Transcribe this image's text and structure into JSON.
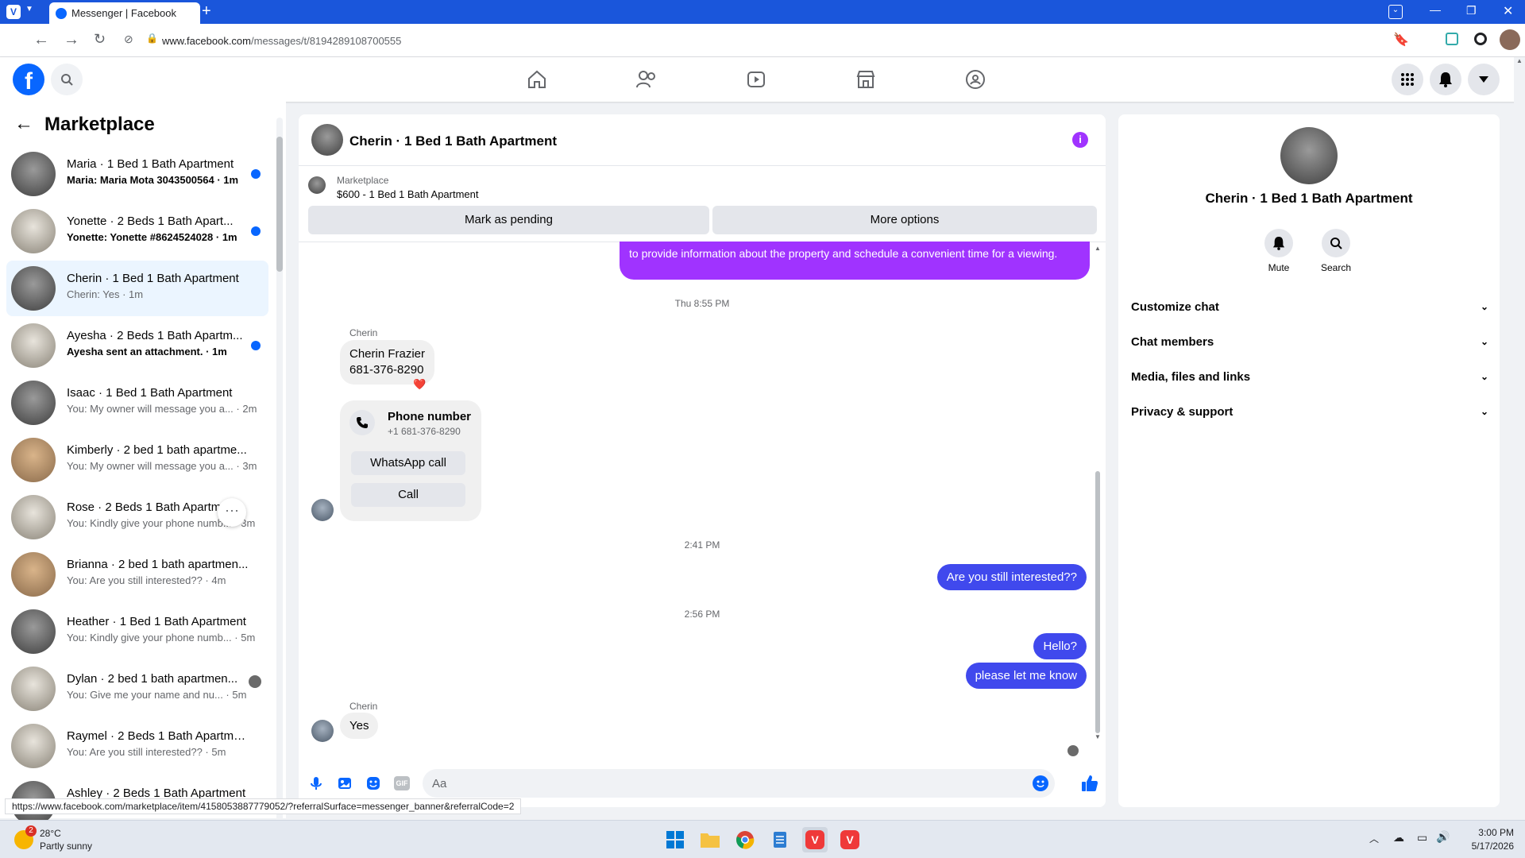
{
  "browser": {
    "tab_title": "Messenger | Facebook",
    "url_host": "www.facebook.com",
    "url_path": "/messages/t/8194289108700555"
  },
  "left_panel": {
    "title": "Marketplace",
    "conversations": [
      {
        "name": "Maria · 1 Bed 1 Bath Apartment",
        "snippet": "Maria: Maria Mota 3043500564 · 1m",
        "unread": true
      },
      {
        "name": "Yonette · 2 Beds 1 Bath Apart...",
        "snippet": "Yonette: Yonette #8624524028 · 1m",
        "unread": true
      },
      {
        "name": "Cherin · 1 Bed 1 Bath Apartment",
        "snippet": "Cherin: Yes · 1m",
        "unread": false
      },
      {
        "name": "Ayesha · 2 Beds 1 Bath Apartm...",
        "snippet": "Ayesha sent an attachment. · 1m",
        "unread": true
      },
      {
        "name": "Isaac · 1 Bed 1 Bath Apartment",
        "snippet": "You: My owner will message you a... · 2m",
        "unread": false
      },
      {
        "name": "Kimberly · 2 bed 1 bath apartme...",
        "snippet": "You: My owner will message you a... · 3m",
        "unread": false
      },
      {
        "name": "Rose · 2 Beds 1 Bath Apartme...",
        "snippet": "You: Kindly give your phone numb... · 3m",
        "unread": false
      },
      {
        "name": "Brianna · 2 bed 1 bath apartmen...",
        "snippet": "You: Are you still interested?? · 4m",
        "unread": false
      },
      {
        "name": "Heather · 1 Bed 1 Bath Apartment",
        "snippet": "You: Kindly give your phone numb... · 5m",
        "unread": false
      },
      {
        "name": "Dylan · 2 bed 1 bath apartmen...",
        "snippet": "You: Give me your name and nu... · 5m",
        "unread": false
      },
      {
        "name": "Raymel · 2 Beds 1 Bath Apartment",
        "snippet": "You: Are you still interested?? · 5m",
        "unread": false
      },
      {
        "name": "Ashley · 2 Beds 1 Bath Apartment",
        "snippet": "",
        "unread": false
      }
    ]
  },
  "chat": {
    "title": "Cherin · 1 Bed 1 Bath Apartment",
    "listing_source": "Marketplace",
    "listing_title": "$600 - 1 Bed 1 Bath Apartment",
    "mark_pending_label": "Mark as pending",
    "more_options_label": "More options",
    "prev_message": "to provide information about the property and schedule a convenient time for a viewing.",
    "ts1": "Thu 8:55 PM",
    "sender_name": "Cherin",
    "msg_contact_line1": "Cherin Frazier",
    "msg_contact_line2": "681-376-8290",
    "reaction": "❤️",
    "phone_card_title": "Phone number",
    "phone_card_number": "+1 681-376-8290",
    "whatsapp_label": "WhatsApp call",
    "call_label": "Call",
    "ts2": "2:41 PM",
    "out1": "Are you still interested??",
    "ts3": "2:56 PM",
    "out2": "Hello?",
    "out3": "please let me know",
    "sender_name2": "Cherin",
    "in_last": "Yes",
    "composer_placeholder": "Aa"
  },
  "right_panel": {
    "title": "Cherin · 1 Bed 1 Bath Apartment",
    "mute_label": "Mute",
    "search_label": "Search",
    "sections": [
      "Customize chat",
      "Chat members",
      "Media, files and links",
      "Privacy & support"
    ]
  },
  "status_bar_url": "https://www.facebook.com/marketplace/item/4158053887779052/?referralSurface=messenger_banner&referralCode=2",
  "taskbar": {
    "weather_temp": "28°C",
    "weather_desc": "Partly sunny",
    "weather_badge": "2",
    "time": "3:00 PM",
    "date": "5/17/2026"
  },
  "colors": {
    "fb_blue": "#0866ff",
    "outgoing_bubble": "#4049ed",
    "purple_bubble": "#a033ff",
    "browser_bar": "#1a56db"
  }
}
